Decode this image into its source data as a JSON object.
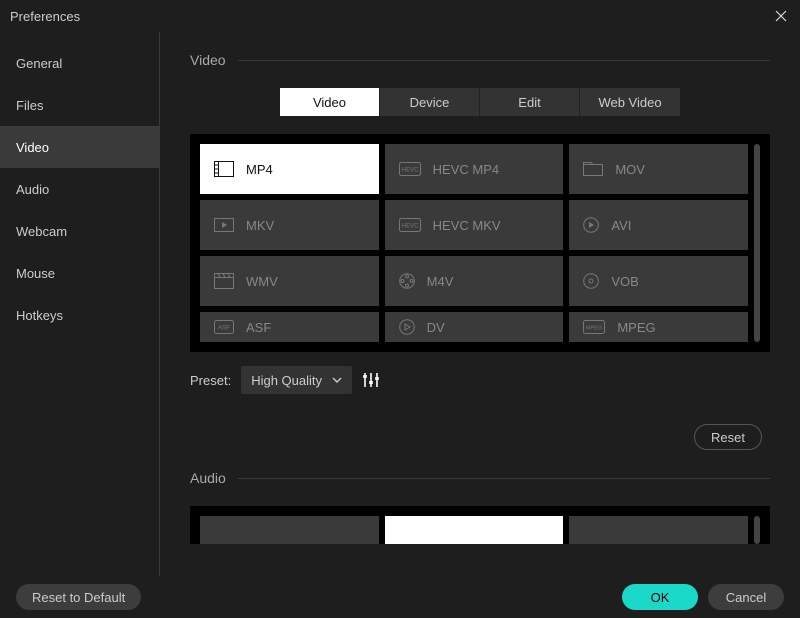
{
  "window": {
    "title": "Preferences"
  },
  "sidebar": {
    "items": [
      {
        "label": "General"
      },
      {
        "label": "Files"
      },
      {
        "label": "Video"
      },
      {
        "label": "Audio"
      },
      {
        "label": "Webcam"
      },
      {
        "label": "Mouse"
      },
      {
        "label": "Hotkeys"
      }
    ],
    "selected_index": 2
  },
  "sections": {
    "video": {
      "title": "Video",
      "tabs": [
        {
          "label": "Video"
        },
        {
          "label": "Device"
        },
        {
          "label": "Edit"
        },
        {
          "label": "Web Video"
        }
      ],
      "active_tab": 0,
      "formats": [
        {
          "label": "MP4",
          "icon": "film-icon"
        },
        {
          "label": "HEVC MP4",
          "icon": "hevc-icon"
        },
        {
          "label": "MOV",
          "icon": "folder-icon"
        },
        {
          "label": "MKV",
          "icon": "play-rect-icon"
        },
        {
          "label": "HEVC MKV",
          "icon": "hevc-icon"
        },
        {
          "label": "AVI",
          "icon": "play-circle-icon"
        },
        {
          "label": "WMV",
          "icon": "clapper-icon"
        },
        {
          "label": "M4V",
          "icon": "reel-icon"
        },
        {
          "label": "VOB",
          "icon": "disc-icon"
        },
        {
          "label": "ASF",
          "icon": "asf-icon"
        },
        {
          "label": "DV",
          "icon": "dv-icon"
        },
        {
          "label": "MPEG",
          "icon": "mpeg-icon"
        }
      ],
      "active_format": 0,
      "preset": {
        "label": "Preset:",
        "value": "High Quality"
      },
      "reset": "Reset"
    },
    "audio": {
      "title": "Audio"
    }
  },
  "footer": {
    "reset_default": "Reset to Default",
    "ok": "OK",
    "cancel": "Cancel"
  }
}
